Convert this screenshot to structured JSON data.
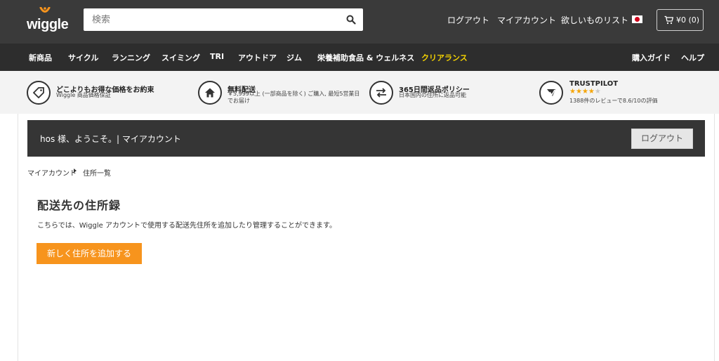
{
  "header": {
    "logo_text": "wiggle",
    "search_placeholder": "検索",
    "links": {
      "logout": "ログアウト",
      "my_account": "マイアカウント",
      "wishlist": "欲しいものリスト"
    },
    "cart": "¥0 (0)"
  },
  "nav": {
    "items": [
      "新商品",
      "サイクル",
      "ランニング",
      "スイミング",
      "TRI",
      "アウトドア",
      "ジム",
      "栄養補助食品 & ウェルネス",
      "クリアランス"
    ],
    "right": [
      "購入ガイド",
      "ヘルプ"
    ],
    "highlight_color": "#f5d300"
  },
  "usp": [
    {
      "title": "どこよりもお得な価格をお約束",
      "sub": "Wiggle 商品価格保証",
      "icon": "price-tag-icon"
    },
    {
      "title": "無料配送",
      "sub": "￥5,999以上 (一部商品を除く) ご購入, 最短5営業日でお届け",
      "icon": "home-icon"
    },
    {
      "title": "365日間返品ポリシー",
      "sub": "日本国内の住所に返品可能",
      "icon": "exchange-arrows-icon"
    },
    {
      "title": "TRUSTPILOT",
      "sub": "1388件のレビューで8.6/10の評価",
      "icon": "trustpilot-icon",
      "rating": 4,
      "max": 5
    }
  ],
  "welcome": {
    "text": "hos 様、ようこそ。| マイアカウント",
    "logout": "ログアウト"
  },
  "breadcrumb": [
    "マイアカウント",
    "住所一覧"
  ],
  "main": {
    "title": "配送先の住所録",
    "description": "こちらでは、Wiggle アカウントで使用する配送先住所を追加したり管理することができます。",
    "add_button": "新しく住所を追加する"
  },
  "colors": {
    "accent": "#f7941d",
    "header_bg": "#3a3a3a",
    "nav_bg": "#2d2d2d",
    "star": "#f5a400"
  }
}
